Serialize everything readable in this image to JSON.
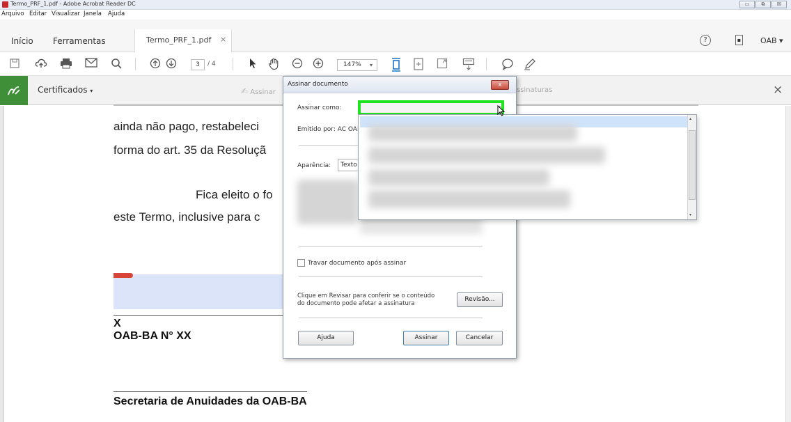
{
  "window": {
    "title": "Termo_PRF_1.pdf - Adobe Acrobat Reader DC",
    "controls": [
      "▭",
      "⧉",
      "☒"
    ]
  },
  "menu": [
    "Arquivo",
    "Editar",
    "Visualizar",
    "Janela",
    "Ajuda"
  ],
  "tabs": {
    "home": "Início",
    "tools": "Ferramentas",
    "document": "Termo_PRF_1.pdf",
    "close_glyph": "×",
    "account": "OAB",
    "account_caret": "▾"
  },
  "toolbar": {
    "page_current": "3",
    "page_total": "/ 4",
    "zoom": "147%",
    "zoom_caret": "▾"
  },
  "certbar": {
    "label": "Certificados",
    "label_caret": "▾",
    "ghost_left": "Assinar",
    "ghost_right": "ssinaturas",
    "close_glyph": "×"
  },
  "document": {
    "lines": [
      "ainda não pago, restabeleci",
      "forma do art. 35 da Resoluçã",
      "Fica eleito o fo",
      "este Termo, inclusive para c"
    ],
    "sig_x": "X",
    "sig_id": "OAB-BA N° XX",
    "secretaria": "Secretaria de Anuidades da OAB-BA"
  },
  "dialog": {
    "title": "Assinar documento",
    "close_glyph": "x",
    "assinar_como_label": "Assinar como:",
    "dropdown_glyph": "▾",
    "emitido_label": "Emitido por: AC OAB",
    "aparencia_label": "Aparência:",
    "aparencia_value": "Texto",
    "lock_label": "Travar documento após assinar",
    "review_text_1": "Clique em Revisar para conferir se o conteúdo",
    "review_text_2": "do documento pode afetar a assinatura",
    "review_button": "Revisão...",
    "help_button": "Ajuda",
    "sign_button": "Assinar",
    "cancel_button": "Cancelar"
  },
  "dropdown_list": {
    "scroll_up": "▴",
    "scroll_down": "▾"
  },
  "colors": {
    "highlight_green": "#1fe31f",
    "cert_green": "#3f8f39",
    "close_red": "#c94a3a",
    "signature_field": "#dbe4f8",
    "selected_row": "#cfe3fb"
  },
  "icons": [
    "acrobat-icon",
    "save-icon",
    "cloud-upload-icon",
    "print-icon",
    "mail-icon",
    "search-icon",
    "page-up-icon",
    "page-down-icon",
    "select-arrow-icon",
    "hand-icon",
    "zoom-out-icon",
    "zoom-in-icon",
    "fit-page-icon",
    "full-screen-icon",
    "scroll-mode-icon",
    "comment-icon",
    "pen-icon",
    "help-icon",
    "mobile-icon",
    "certificate-icon"
  ]
}
